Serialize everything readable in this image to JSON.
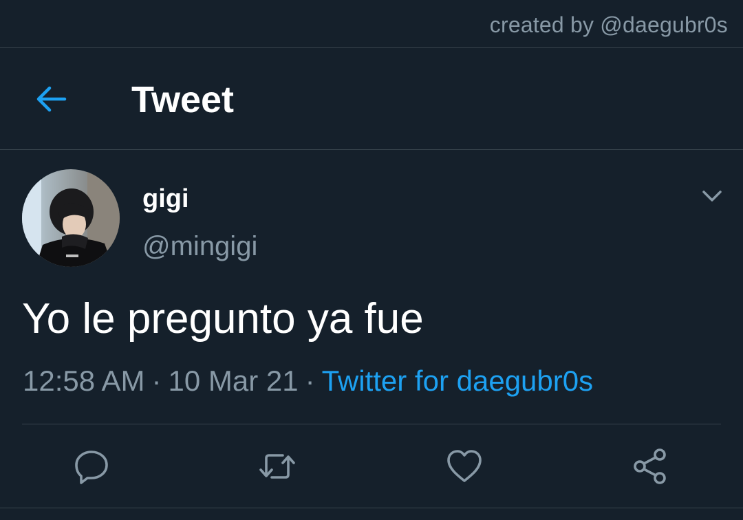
{
  "watermark": "created by @daegubr0s",
  "header": {
    "title": "Tweet"
  },
  "tweet": {
    "user_name": "gigi",
    "user_handle": "@mingigi",
    "text": "Yo le pregunto ya fue",
    "time": "12:58 AM",
    "date": "10 Mar 21",
    "separator": "·",
    "source": "Twitter for daegubr0s"
  },
  "actions": [
    {
      "icon": "reply-icon"
    },
    {
      "icon": "retweet-icon"
    },
    {
      "icon": "like-icon"
    },
    {
      "icon": "share-icon"
    }
  ],
  "colors": {
    "background": "#15202b",
    "accent": "#1da1f2",
    "secondary_text": "#8899a6",
    "divider": "#38444d"
  }
}
